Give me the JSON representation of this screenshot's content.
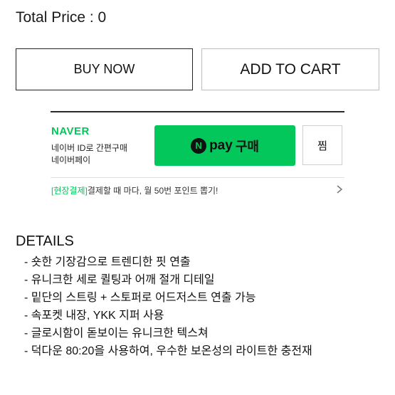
{
  "summary": {
    "total_price": "Total Price : 0"
  },
  "actions": {
    "buy_now": "BUY NOW",
    "add_to_cart": "ADD TO CART"
  },
  "naver_pay": {
    "logo": "NAVER",
    "desc_line1": "네이버 ID로 간편구매",
    "desc_line2": "네이버페이",
    "npay_symbol": "N",
    "pay_label": "pay",
    "buy_label": "구매",
    "zzim_label": "찜",
    "promo_tag": "[현장결제]",
    "promo_text": "결제할 때 마다, 월 50번 포인트 뽑기!",
    "brand_color": "#03c75a"
  },
  "details": {
    "title": "DETAILS",
    "items": [
      "- 숏한 기장감으로 트렌디한 핏 연출",
      "- 유니크한 세로 퀼팅과 어깨 절개 디테일",
      "- 밑단의 스트링 + 스토퍼로 어드저스트 연출 가능",
      "- 속포켓 내장, YKK 지퍼 사용",
      "- 글로시함이 돋보이는 유니크한 텍스쳐",
      "- 덕다운 80:20을 사용하여, 우수한 보온성의 라이트한 충전재"
    ]
  }
}
